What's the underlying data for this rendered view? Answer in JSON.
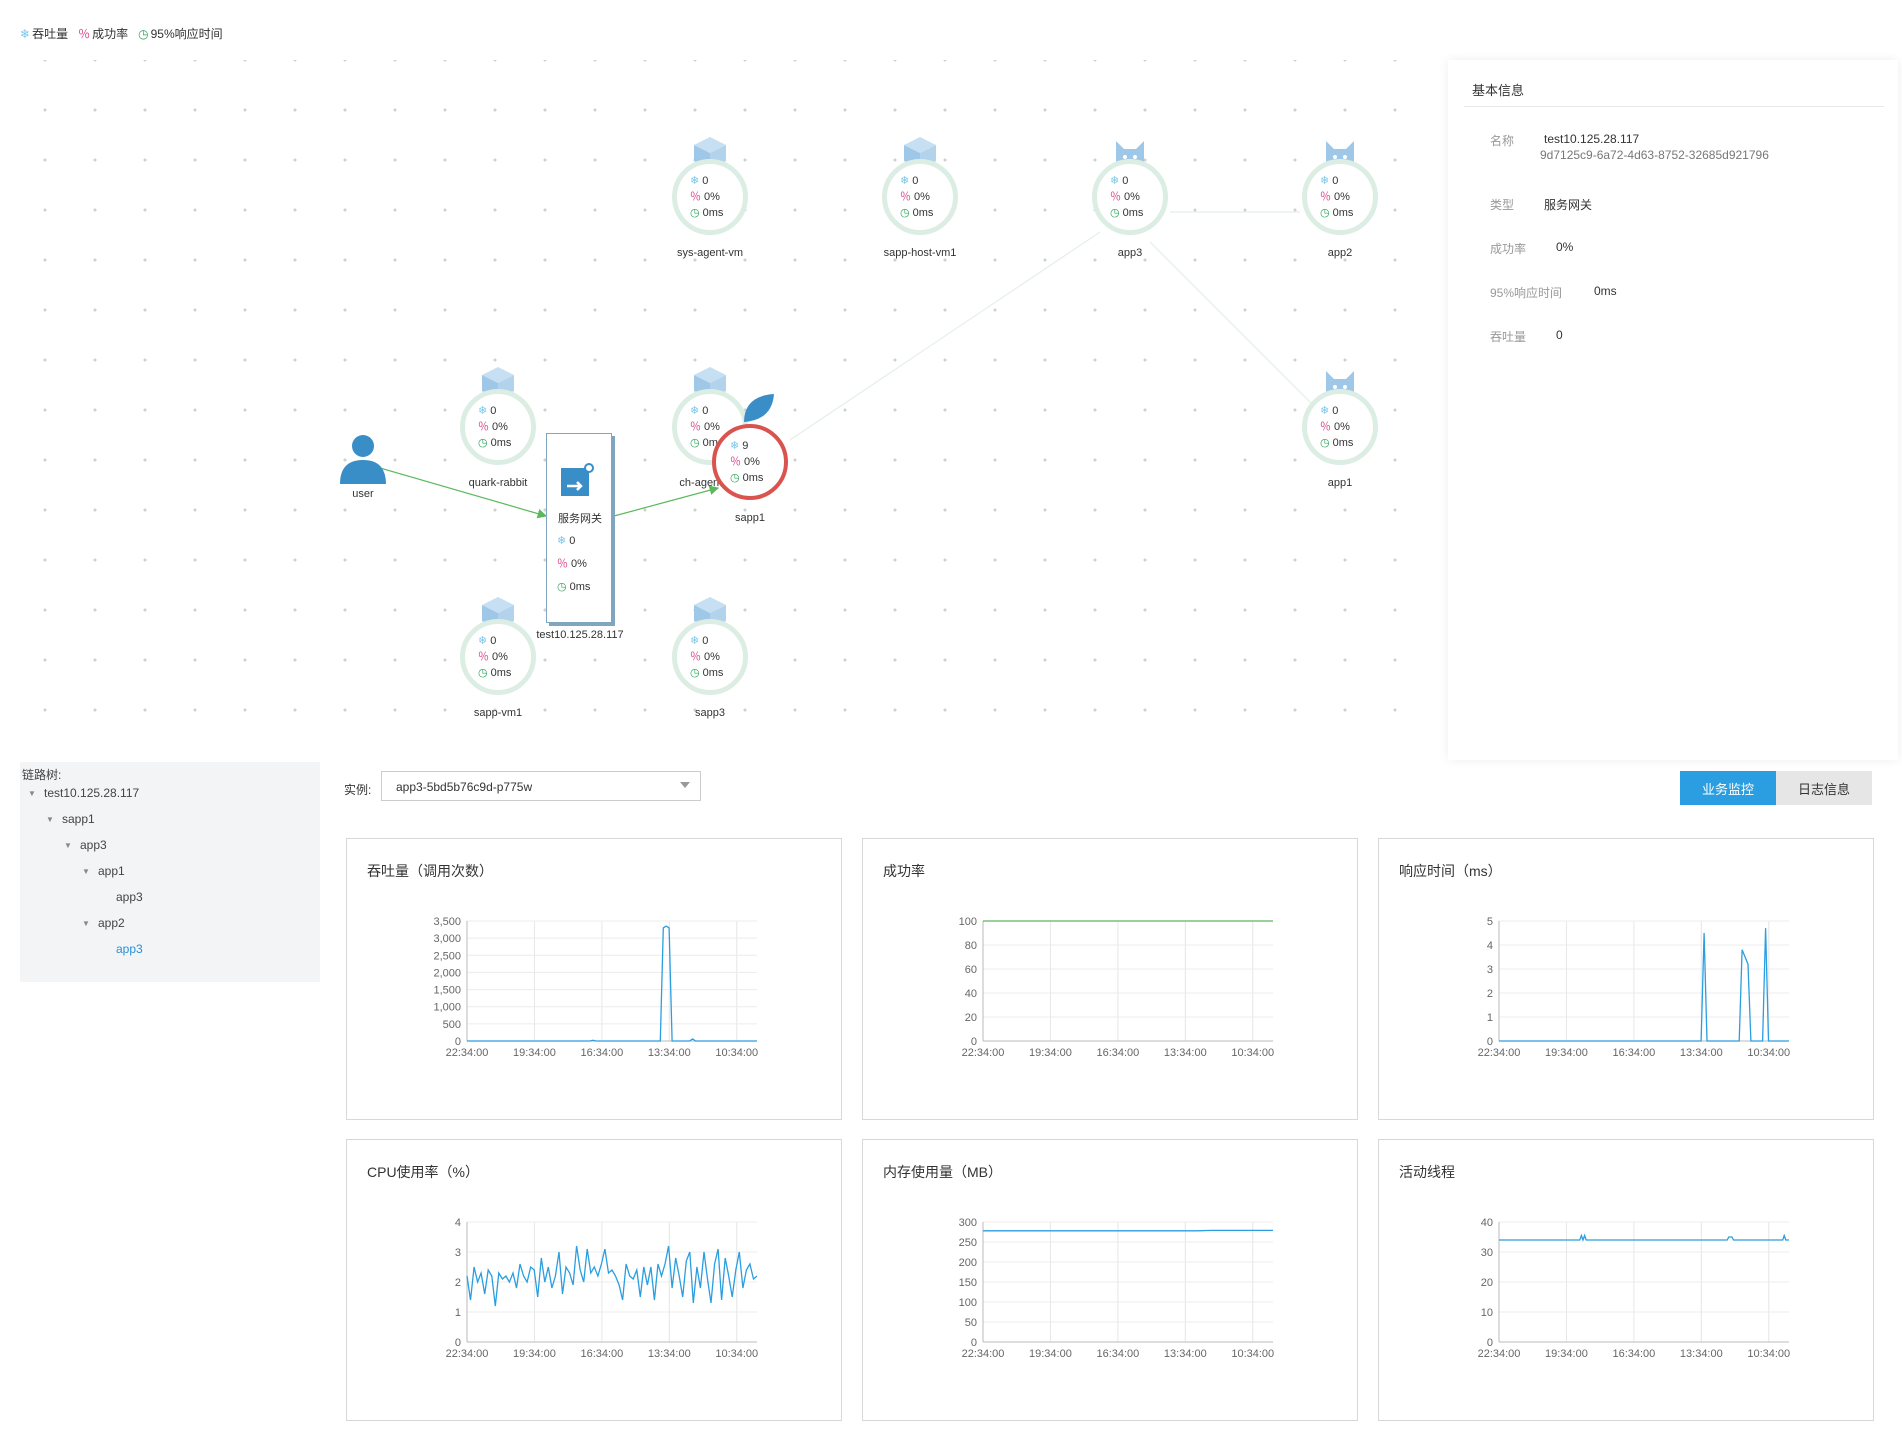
{
  "legend": {
    "throughput": "吞吐量",
    "success": "成功率",
    "response": "95%响应时间"
  },
  "nodes": [
    {
      "id": "sys-agent-vm",
      "label": "sys-agent-vm",
      "icon": "cube-icon",
      "tp": "0",
      "sr": "0%",
      "rt": "0ms"
    },
    {
      "id": "sapp-host-vm1",
      "label": "sapp-host-vm1",
      "icon": "cube-icon",
      "tp": "0",
      "sr": "0%",
      "rt": "0ms"
    },
    {
      "id": "app3",
      "label": "app3",
      "icon": "cat-icon",
      "tp": "0",
      "sr": "0%",
      "rt": "0ms"
    },
    {
      "id": "app2",
      "label": "app2",
      "icon": "cat-icon",
      "tp": "0",
      "sr": "0%",
      "rt": "0ms"
    },
    {
      "id": "quark-rabbit",
      "label": "quark-rabbit",
      "icon": "cube-icon",
      "tp": "0",
      "sr": "0%",
      "rt": "0ms"
    },
    {
      "id": "ch-agent-vm",
      "label": "ch-agent-vm",
      "icon": "cube-icon",
      "tp": "0",
      "sr": "0%",
      "rt": "0ms"
    },
    {
      "id": "app1",
      "label": "app1",
      "icon": "cat-icon",
      "tp": "0",
      "sr": "0%",
      "rt": "0ms"
    },
    {
      "id": "sapp-vm1",
      "label": "sapp-vm1",
      "icon": "cube-icon",
      "tp": "0",
      "sr": "0%",
      "rt": "0ms"
    },
    {
      "id": "sapp3",
      "label": "sapp3",
      "icon": "cube-icon",
      "tp": "0",
      "sr": "0%",
      "rt": "0ms"
    },
    {
      "id": "sapp1",
      "label": "sapp1",
      "icon": "leaf-icon",
      "tp": "9",
      "sr": "0%",
      "rt": "0ms"
    }
  ],
  "user": {
    "label": "user"
  },
  "gateway": {
    "title": "服务网关",
    "label": "test10.125.28.117",
    "tp": "0",
    "sr": "0%",
    "rt": "0ms"
  },
  "info": {
    "title": "基本信息",
    "name_key": "名称",
    "name_value": "test10.125.28.117",
    "uuid": "9d7125c9-6a72-4d63-8752-32685d921796",
    "type_key": "类型",
    "type_value": "服务网关",
    "success_key": "成功率",
    "success_value": "0%",
    "rt_key": "95%响应时间",
    "rt_value": "0ms",
    "tp_key": "吞吐量",
    "tp_value": "0"
  },
  "tree": {
    "title": "链路树:",
    "items": [
      {
        "label": "test10.125.28.117",
        "caret": "▼"
      },
      {
        "label": "sapp1",
        "caret": "▼"
      },
      {
        "label": "app3",
        "caret": "▼"
      },
      {
        "label": "app1",
        "caret": "▼"
      },
      {
        "label": "app3",
        "caret": ""
      },
      {
        "label": "app2",
        "caret": "▼"
      },
      {
        "label": "app3",
        "caret": ""
      }
    ]
  },
  "instance": {
    "label": "实例:",
    "value": "app3-5bd5b76c9d-p775w"
  },
  "tabs": {
    "monitor": "业务监控",
    "logs": "日志信息"
  },
  "chart_data": [
    {
      "type": "line",
      "title": "吞吐量（调用次数）",
      "categories": [
        "22:34:00",
        "19:34:00",
        "16:34:00",
        "13:34:00",
        "10:34:00"
      ],
      "yticks": [
        "0",
        "500",
        "1,000",
        "1,500",
        "2,000",
        "2,500",
        "3,000",
        "3,500"
      ],
      "ylim": [
        0,
        3500
      ],
      "series": [
        {
          "values": [
            0,
            0,
            0,
            0,
            0,
            0,
            0,
            0,
            0,
            0,
            0,
            0,
            0,
            0,
            0,
            0,
            0,
            0,
            0,
            0,
            0,
            0,
            0,
            0,
            0,
            0,
            0,
            0,
            0,
            0,
            0,
            0,
            0,
            0,
            0,
            0,
            0,
            0,
            0,
            0,
            0,
            0,
            0,
            20,
            0,
            0,
            0,
            0,
            0,
            0,
            0,
            0,
            0,
            0,
            0,
            0,
            0,
            0,
            0,
            0,
            0,
            0,
            0,
            0,
            0,
            0,
            0,
            3300,
            3350,
            3300,
            0,
            0,
            0,
            0,
            0,
            0,
            0,
            60,
            0,
            0,
            0,
            0,
            0,
            0,
            0,
            0,
            0,
            0,
            0,
            0,
            0,
            0,
            0,
            0,
            0,
            0,
            0,
            0,
            0,
            0
          ]
        }
      ]
    },
    {
      "type": "line",
      "title": "成功率",
      "categories": [
        "22:34:00",
        "19:34:00",
        "16:34:00",
        "13:34:00",
        "10:34:00"
      ],
      "yticks": [
        "0",
        "20",
        "40",
        "60",
        "80",
        "100"
      ],
      "ylim": [
        0,
        100
      ],
      "series": [
        {
          "values": [
            100,
            100,
            100,
            100,
            100,
            100,
            100,
            100,
            100,
            100,
            100,
            100,
            100,
            100,
            100,
            100,
            100,
            100,
            100,
            100
          ]
        }
      ]
    },
    {
      "type": "line",
      "title": "响应时间（ms）",
      "categories": [
        "22:34:00",
        "19:34:00",
        "16:34:00",
        "13:34:00",
        "10:34:00"
      ],
      "yticks": [
        "0",
        "1",
        "2",
        "3",
        "4",
        "5"
      ],
      "ylim": [
        0,
        5
      ],
      "series": [
        {
          "values": [
            0,
            0,
            0,
            0,
            0,
            0,
            0,
            0,
            0,
            0,
            0,
            0,
            0,
            0,
            0,
            0,
            0,
            0,
            0,
            0,
            0,
            0,
            0,
            0,
            0,
            0,
            0,
            0,
            0,
            0,
            0,
            0,
            0,
            0,
            0,
            0,
            0,
            0,
            0,
            0,
            0,
            0,
            0,
            0,
            0,
            0,
            0,
            0,
            0,
            0,
            0,
            0,
            0,
            0,
            0,
            0,
            0,
            0,
            0,
            0,
            0,
            0,
            0,
            0,
            0,
            0,
            0,
            0,
            0,
            0,
            4.5,
            0,
            0,
            0,
            0,
            0,
            0,
            0,
            0,
            0,
            0,
            0,
            0,
            3.8,
            3.5,
            3.2,
            0,
            0,
            0,
            0,
            0,
            4.7,
            0,
            0,
            0,
            0,
            0,
            0,
            0,
            0
          ]
        }
      ]
    },
    {
      "type": "line",
      "title": "CPU使用率（%）",
      "categories": [
        "22:34:00",
        "19:34:00",
        "16:34:00",
        "13:34:00",
        "10:34:00"
      ],
      "yticks": [
        "0",
        "1",
        "2",
        "3",
        "4"
      ],
      "ylim": [
        0,
        4
      ],
      "series": [
        {
          "values": [
            2.2,
            1.4,
            2.5,
            2.0,
            2.3,
            1.6,
            2.4,
            2.2,
            1.2,
            2.3,
            2.1,
            2.2,
            2.0,
            2.3,
            1.8,
            2.6,
            2.2,
            2.0,
            2.5,
            2.4,
            1.5,
            2.8,
            2.0,
            2.5,
            1.8,
            2.2,
            3.0,
            1.6,
            2.5,
            2.3,
            1.9,
            3.2,
            2.4,
            2.0,
            3.1,
            2.3,
            2.5,
            2.2,
            2.6,
            3.1,
            2.3,
            2.4,
            2.2,
            1.9,
            1.4,
            2.6,
            2.2,
            2.1,
            2.4,
            1.5,
            2.5,
            1.9,
            2.5,
            1.4,
            2.6,
            2.2,
            2.6,
            3.2,
            1.8,
            2.8,
            2.2,
            1.5,
            2.7,
            3.0,
            1.3,
            2.5,
            1.8,
            3.0,
            2.1,
            1.3,
            2.6,
            3.1,
            1.4,
            2.8,
            2.2,
            1.5,
            2.4,
            3.0,
            1.8,
            2.4,
            2.6,
            2.1,
            2.2
          ]
        }
      ]
    },
    {
      "type": "line",
      "title": "内存使用量（MB）",
      "categories": [
        "22:34:00",
        "19:34:00",
        "16:34:00",
        "13:34:00",
        "10:34:00"
      ],
      "yticks": [
        "0",
        "50",
        "100",
        "150",
        "200",
        "250",
        "300"
      ],
      "ylim": [
        0,
        300
      ],
      "series": [
        {
          "values": [
            278,
            278,
            278,
            278,
            278,
            278,
            278,
            278,
            278,
            278,
            278,
            278,
            278,
            278,
            278,
            279,
            279,
            279,
            279,
            279
          ]
        }
      ]
    },
    {
      "type": "line",
      "title": "活动线程",
      "categories": [
        "22:34:00",
        "19:34:00",
        "16:34:00",
        "13:34:00",
        "10:34:00"
      ],
      "yticks": [
        "0",
        "10",
        "20",
        "30",
        "40"
      ],
      "ylim": [
        0,
        40
      ],
      "series": [
        {
          "values": [
            34,
            34,
            34,
            34,
            34,
            34,
            34,
            34,
            34,
            34,
            34,
            34,
            34,
            34,
            34,
            34,
            34,
            34,
            34,
            34,
            34,
            34,
            34,
            34,
            34,
            34,
            34,
            34,
            34,
            34,
            34,
            34,
            34,
            34,
            34,
            34,
            34,
            34,
            34,
            34,
            34,
            34,
            34,
            34,
            34,
            34,
            34,
            34,
            34,
            34,
            34,
            34,
            35.5,
            34,
            35.5,
            34,
            34,
            34,
            34,
            34,
            34,
            34,
            34,
            34,
            34,
            34,
            34,
            34,
            34,
            34,
            34,
            34,
            34,
            34,
            34,
            34,
            34,
            34,
            34,
            34,
            34,
            34,
            34,
            34,
            34,
            34,
            34,
            34,
            34,
            34,
            34,
            34,
            34,
            34,
            34,
            34,
            34,
            34,
            34,
            34,
            34,
            34,
            34,
            34,
            34,
            34,
            34,
            34,
            34,
            34,
            34,
            34,
            34,
            34,
            34,
            34,
            34,
            34,
            34,
            34,
            34,
            34,
            34,
            34,
            34,
            34,
            34,
            34,
            34,
            34,
            34,
            34,
            34,
            34,
            34,
            34,
            34,
            34,
            34,
            34,
            34,
            34,
            34,
            34,
            34,
            35,
            35,
            35,
            34,
            34,
            34,
            34,
            34,
            34,
            34,
            34,
            34,
            34,
            34,
            34,
            34,
            34,
            34,
            34,
            34,
            34,
            34,
            34,
            34,
            34,
            34,
            34,
            34,
            34,
            34,
            34,
            34,
            34,
            34,
            34,
            35.5,
            34,
            34,
            34
          ]
        }
      ]
    }
  ]
}
